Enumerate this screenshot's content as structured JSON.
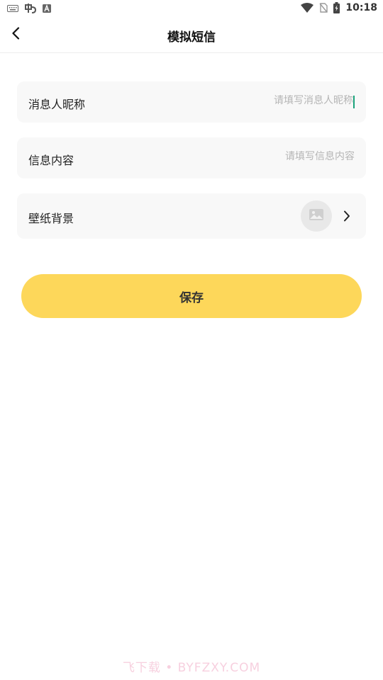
{
  "status_bar": {
    "time": "10:18",
    "icons": [
      "keyboard-icon",
      "app-logo-icon",
      "font-a-icon",
      "wifi-icon",
      "no-sim-icon",
      "battery-charging-icon"
    ]
  },
  "header": {
    "back_icon": "chevron-left-icon",
    "title": "模拟短信"
  },
  "form": {
    "nickname": {
      "label": "消息人昵称",
      "value": "",
      "placeholder": "请填写消息人昵称"
    },
    "content": {
      "label": "信息内容",
      "value": "",
      "placeholder": "请填写信息内容"
    },
    "wallpaper": {
      "label": "壁纸背景",
      "thumb_icon": "image-placeholder-icon",
      "arrow_icon": "chevron-right-icon"
    }
  },
  "save_button": {
    "label": "保存",
    "color": "#fdd75a"
  },
  "watermark": {
    "text": "飞下载 • BYFZXY.COM"
  },
  "colors": {
    "row_background": "#f8f8f8",
    "caret": "#1aa27a",
    "placeholder": "#b5b5b5"
  }
}
